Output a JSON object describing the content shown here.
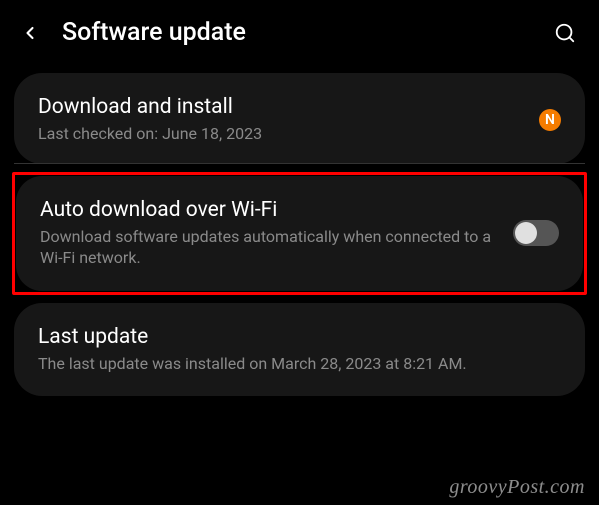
{
  "header": {
    "title": "Software update"
  },
  "download_install": {
    "title": "Download and install",
    "subtitle": "Last checked on: June 18, 2023",
    "badge": "N"
  },
  "auto_download": {
    "title": "Auto download over Wi-Fi",
    "subtitle": "Download software updates automatically when connected to a Wi-Fi network.",
    "toggle_on": false
  },
  "last_update": {
    "title": "Last update",
    "subtitle": "The last update was installed on March 28, 2023 at 8:21 AM."
  },
  "watermark": "groovyPost.com"
}
